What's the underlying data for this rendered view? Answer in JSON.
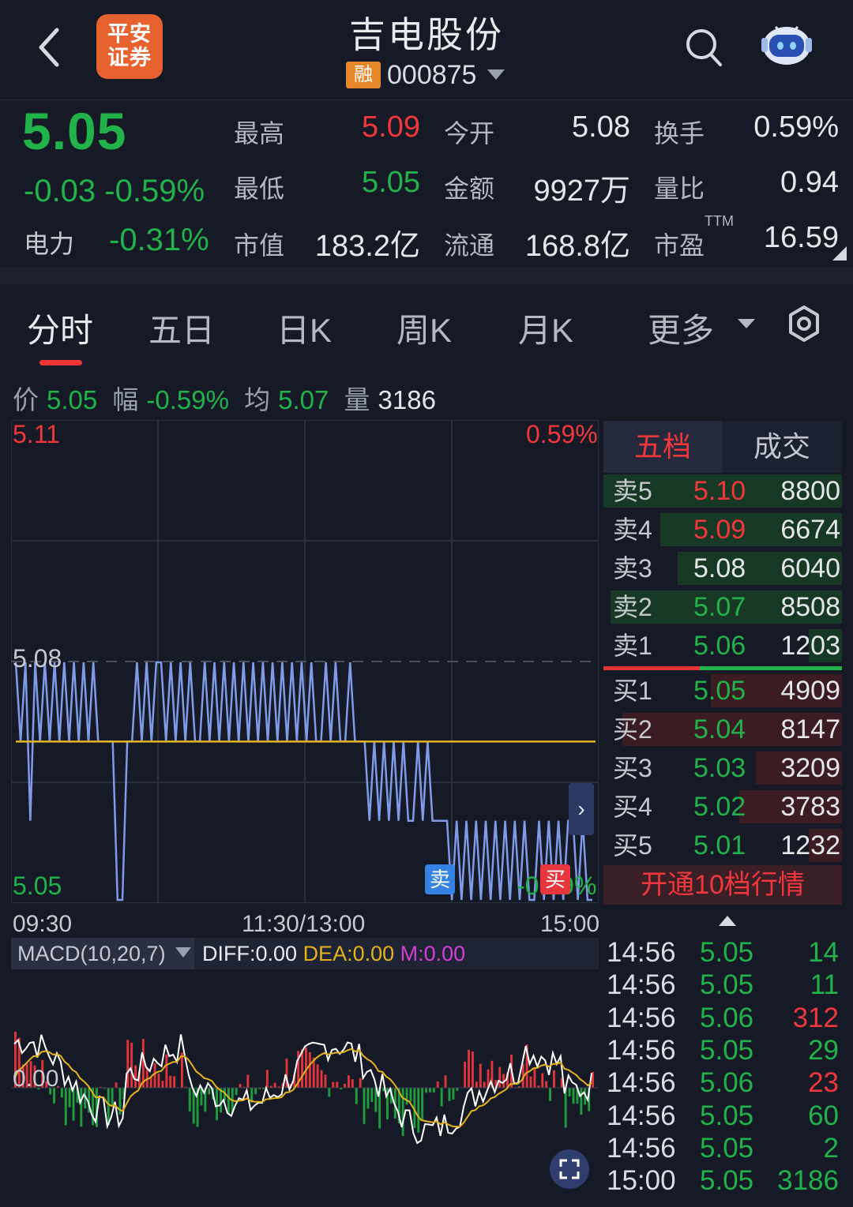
{
  "header": {
    "brand": "平安\n证券",
    "stock_name": "吉电股份",
    "margin_badge": "融",
    "stock_code": "000875"
  },
  "quote": {
    "price": "5.05",
    "change": "-0.03",
    "change_pct": "-0.59%",
    "sector_label": "电力",
    "sector_change": "-0.31%",
    "fields": [
      {
        "label": "最高",
        "value": "5.09",
        "color": "#f0373b"
      },
      {
        "label": "今开",
        "value": "5.08",
        "color": "#e4e6ea"
      },
      {
        "label": "换手",
        "value": "0.59%",
        "color": "#e4e6ea"
      },
      {
        "label": "最低",
        "value": "5.05",
        "color": "#21b24a"
      },
      {
        "label": "金额",
        "value": "9927万",
        "color": "#e4e6ea"
      },
      {
        "label": "量比",
        "value": "0.94",
        "color": "#e4e6ea"
      },
      {
        "label": "市值",
        "value": "183.2亿",
        "color": "#e4e6ea"
      },
      {
        "label": "流通",
        "value": "168.8亿",
        "color": "#e4e6ea"
      },
      {
        "label": "市盈",
        "value": "16.59",
        "color": "#e4e6ea"
      }
    ],
    "ttm_label": "TTM"
  },
  "tabs": [
    "分时",
    "五日",
    "日K",
    "周K",
    "月K",
    "更多"
  ],
  "infoline": {
    "price_label": "价",
    "price": "5.05",
    "range_label": "幅",
    "range": "-0.59%",
    "avg_label": "均",
    "avg": "5.07",
    "vol_label": "量",
    "vol": "3186"
  },
  "intraday": {
    "price_max": "5.11",
    "pct_max": "0.59%",
    "price_mid": "5.08",
    "price_min": "5.05",
    "pct_min": "-0.59%",
    "time_start": "09:30",
    "time_mid": "11:30/13:00",
    "time_end": "15:00",
    "sell_marker": "卖",
    "buy_marker": "买",
    "expand_icon": "›"
  },
  "chart_data": {
    "type": "line",
    "ylim": [
      5.05,
      5.11
    ],
    "avg_price": 5.07,
    "reference_price": 5.08,
    "series": [
      {
        "values": [
          5.08,
          5.07,
          5.08,
          5.06,
          5.08,
          5.07,
          5.08,
          5.07,
          5.08,
          5.07,
          5.08,
          5.07,
          5.08,
          5.07,
          5.08,
          5.07,
          5.08,
          5.07,
          5.07,
          5.07,
          5.07,
          5.05,
          5.05,
          5.07,
          5.07,
          5.08,
          5.07,
          5.08,
          5.07,
          5.08,
          5.08,
          5.07,
          5.08,
          5.07,
          5.08,
          5.07,
          5.08,
          5.07,
          5.07,
          5.08,
          5.07,
          5.08,
          5.07,
          5.08,
          5.07,
          5.08,
          5.07,
          5.08,
          5.07,
          5.08,
          5.07,
          5.08,
          5.07,
          5.08,
          5.07,
          5.08,
          5.07,
          5.08,
          5.07,
          5.08,
          5.07,
          5.08,
          5.07,
          5.07,
          5.08,
          5.07,
          5.08,
          5.07,
          5.07,
          5.08,
          5.07,
          5.07,
          5.07,
          5.06,
          5.07,
          5.06,
          5.07,
          5.06,
          5.07,
          5.06,
          5.07,
          5.06,
          5.06,
          5.07,
          5.06,
          5.07,
          5.06,
          5.06,
          5.06,
          5.06,
          5.05,
          5.06,
          5.05,
          5.06,
          5.05,
          5.06,
          5.05,
          5.06,
          5.05,
          5.06,
          5.05,
          5.06,
          5.05,
          5.06,
          5.05,
          5.06,
          5.05,
          5.05,
          5.06,
          5.05,
          5.06,
          5.05,
          5.06,
          5.05,
          5.06,
          5.06,
          5.05,
          5.06,
          5.05,
          5.05
        ]
      }
    ]
  },
  "orderbook": {
    "tab_active": "五档",
    "tab_other": "成交",
    "asks": [
      {
        "label": "卖5",
        "price": "5.10",
        "vol": "8800",
        "price_color": "#f0373b",
        "fill": 1.0
      },
      {
        "label": "卖4",
        "price": "5.09",
        "vol": "6674",
        "price_color": "#f0373b",
        "fill": 0.76
      },
      {
        "label": "卖3",
        "price": "5.08",
        "vol": "6040",
        "price_color": "#e4e6ea",
        "fill": 0.69
      },
      {
        "label": "卖2",
        "price": "5.07",
        "vol": "8508",
        "price_color": "#21b24a",
        "fill": 0.97
      },
      {
        "label": "卖1",
        "price": "5.06",
        "vol": "1203",
        "price_color": "#21b24a",
        "fill": 0.14
      }
    ],
    "bids": [
      {
        "label": "买1",
        "price": "5.05",
        "vol": "4909",
        "price_color": "#21b24a",
        "fill": 0.55
      },
      {
        "label": "买2",
        "price": "5.04",
        "vol": "8147",
        "price_color": "#21b24a",
        "fill": 0.92
      },
      {
        "label": "买3",
        "price": "5.03",
        "vol": "3209",
        "price_color": "#21b24a",
        "fill": 0.36
      },
      {
        "label": "买4",
        "price": "5.02",
        "vol": "3783",
        "price_color": "#21b24a",
        "fill": 0.43
      },
      {
        "label": "买5",
        "price": "5.01",
        "vol": "1232",
        "price_color": "#21b24a",
        "fill": 0.14
      }
    ],
    "open_level10": "开通10档行情"
  },
  "macd": {
    "title": "MACD(10,20,7)",
    "diff": "DIFF:0.00",
    "dea": "DEA:0.00",
    "m": "M:0.00",
    "zero_label": "0.00",
    "colors": {
      "diff": "#ffffff",
      "dea": "#e3b21c",
      "m": "#d43fd4"
    }
  },
  "ticks": [
    {
      "time": "14:56",
      "price": "5.05",
      "vol": "14",
      "vol_color": "#21b24a"
    },
    {
      "time": "14:56",
      "price": "5.05",
      "vol": "11",
      "vol_color": "#21b24a"
    },
    {
      "time": "14:56",
      "price": "5.06",
      "vol": "312",
      "vol_color": "#f0373b"
    },
    {
      "time": "14:56",
      "price": "5.05",
      "vol": "29",
      "vol_color": "#21b24a"
    },
    {
      "time": "14:56",
      "price": "5.06",
      "vol": "23",
      "vol_color": "#f0373b"
    },
    {
      "time": "14:56",
      "price": "5.05",
      "vol": "60",
      "vol_color": "#21b24a"
    },
    {
      "time": "14:56",
      "price": "5.05",
      "vol": "2",
      "vol_color": "#21b24a"
    },
    {
      "time": "15:00",
      "price": "5.05",
      "vol": "3186",
      "vol_color": "#21b24a"
    }
  ]
}
